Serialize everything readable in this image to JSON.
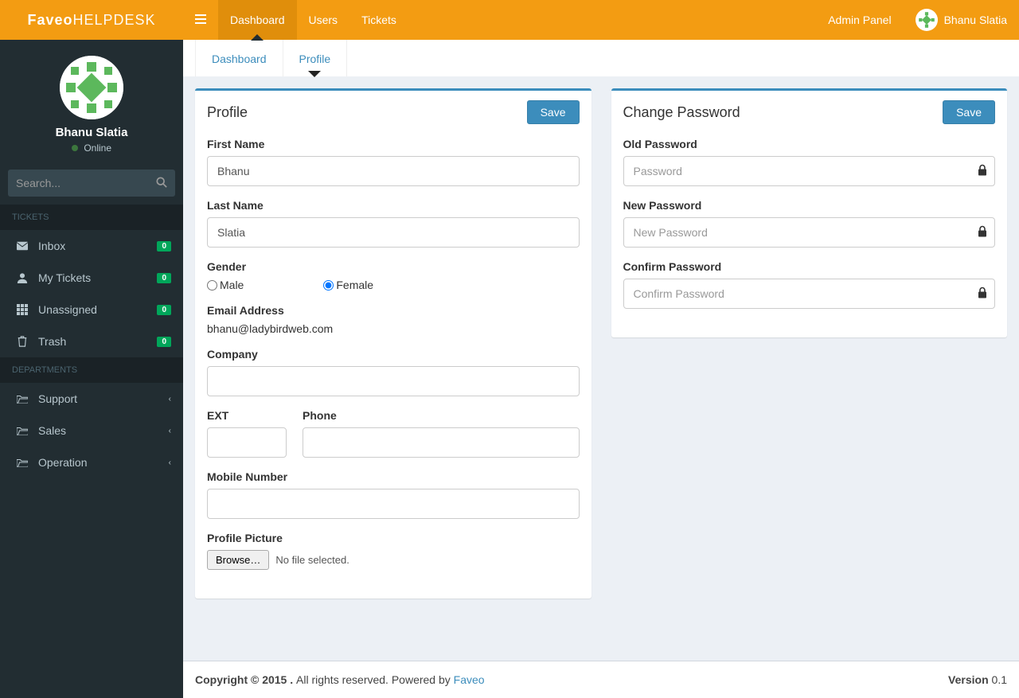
{
  "brand": {
    "bold": "Faveo",
    "light": " HELPDESK"
  },
  "topnav": {
    "dashboard": "Dashboard",
    "users": "Users",
    "tickets": "Tickets",
    "admin_panel": "Admin Panel",
    "username": "Bhanu Slatia"
  },
  "sidebar": {
    "user": {
      "name": "Bhanu Slatia",
      "status": "Online"
    },
    "search_placeholder": "Search...",
    "header_tickets": "TICKETS",
    "header_departments": "DEPARTMENTS",
    "tickets": [
      {
        "label": "Inbox",
        "badge": "0"
      },
      {
        "label": "My Tickets",
        "badge": "0"
      },
      {
        "label": "Unassigned",
        "badge": "0"
      },
      {
        "label": "Trash",
        "badge": "0"
      }
    ],
    "departments": [
      {
        "label": "Support"
      },
      {
        "label": "Sales"
      },
      {
        "label": "Operation"
      }
    ]
  },
  "tabs": {
    "dashboard": "Dashboard",
    "profile": "Profile"
  },
  "profile": {
    "title": "Profile",
    "save": "Save",
    "labels": {
      "first_name": "First Name",
      "last_name": "Last Name",
      "gender": "Gender",
      "male": "Male",
      "female": "Female",
      "email": "Email Address",
      "company": "Company",
      "ext": "EXT",
      "phone": "Phone",
      "mobile": "Mobile Number",
      "picture": "Profile Picture",
      "browse": "Browse…",
      "no_file": "No file selected."
    },
    "values": {
      "first_name": "Bhanu",
      "last_name": "Slatia",
      "email": "bhanu@ladybirdweb.com",
      "company": "",
      "ext": "",
      "phone": "",
      "mobile": "",
      "gender": "female"
    }
  },
  "password": {
    "title": "Change Password",
    "save": "Save",
    "labels": {
      "old": "Old Password",
      "new": "New Password",
      "confirm": "Confirm Password"
    },
    "placeholders": {
      "old": "Password",
      "new": "New Password",
      "confirm": "Confirm Password"
    }
  },
  "footer": {
    "copyright": "Copyright © 2015 . ",
    "rights": "All rights reserved. Powered by ",
    "faveo": "Faveo",
    "version_label": "Version",
    "version": " 0.1"
  }
}
